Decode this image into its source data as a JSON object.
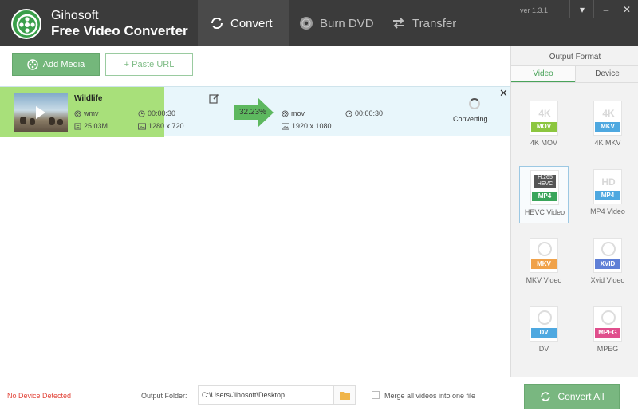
{
  "app": {
    "name_line1": "Gihosoft",
    "name_line2": "Free Video Converter",
    "version": "ver 1.3.1"
  },
  "nav_tabs": [
    {
      "label": "Convert",
      "icon": "convert-icon",
      "active": true
    },
    {
      "label": "Burn DVD",
      "icon": "disc-icon",
      "active": false
    },
    {
      "label": "Transfer",
      "icon": "transfer-icon",
      "active": false
    }
  ],
  "window_controls": {
    "menu": "▾",
    "minimize": "–",
    "close": "✕"
  },
  "toolbar": {
    "add_media_label": "Add Media",
    "paste_url_label": "+ Paste URL"
  },
  "file": {
    "name": "Wildlife",
    "source": {
      "format": "wmv",
      "duration": "00:00:30",
      "size": "25.03M",
      "resolution": "1280 x 720"
    },
    "target": {
      "format": "mov",
      "duration": "00:00:30",
      "resolution": "1920 x 1080"
    },
    "progress_label": "32.23%",
    "progress_fraction": 0.3223,
    "status": "Converting"
  },
  "output_format": {
    "title": "Output Format",
    "tabs": [
      {
        "label": "Video",
        "active": true
      },
      {
        "label": "Device",
        "active": false
      }
    ],
    "items": [
      {
        "big": "4K",
        "badge": "MOV",
        "badge_color": "#8cc63f",
        "label": "4K MOV",
        "selected": false
      },
      {
        "big": "4K",
        "badge": "MKV",
        "badge_color": "#4ea8e0",
        "label": "4K MKV",
        "selected": false
      },
      {
        "big": "H.265 HEVC",
        "badge": "MP4",
        "badge_color": "#3aa55a",
        "label": "HEVC Video",
        "selected": true
      },
      {
        "big": "HD",
        "badge": "MP4",
        "badge_color": "#4ea8e0",
        "label": "MP4 Video",
        "selected": false
      },
      {
        "big": "",
        "badge": "MKV",
        "badge_color": "#f0a24a",
        "label": "MKV Video",
        "selected": false
      },
      {
        "big": "",
        "badge": "XVID",
        "badge_color": "#5f7fd6",
        "label": "Xvid Video",
        "selected": false
      },
      {
        "big": "",
        "badge": "DV",
        "badge_color": "#4ea8e0",
        "label": "DV",
        "selected": false
      },
      {
        "big": "",
        "badge": "MPEG",
        "badge_color": "#e04e8c",
        "label": "MPEG",
        "selected": false
      }
    ]
  },
  "bottom": {
    "device_status": "No Device Detected",
    "output_folder_label": "Output Folder:",
    "output_folder_value": "C:\\Users\\Jihosoft\\Desktop",
    "merge_label": "Merge all videos into one file",
    "convert_all_label": "Convert All"
  },
  "colors": {
    "titlebar": "#3b3b3b",
    "accent_green": "#79b780",
    "progress_green": "#a8e07a",
    "error_red": "#e2453a"
  }
}
